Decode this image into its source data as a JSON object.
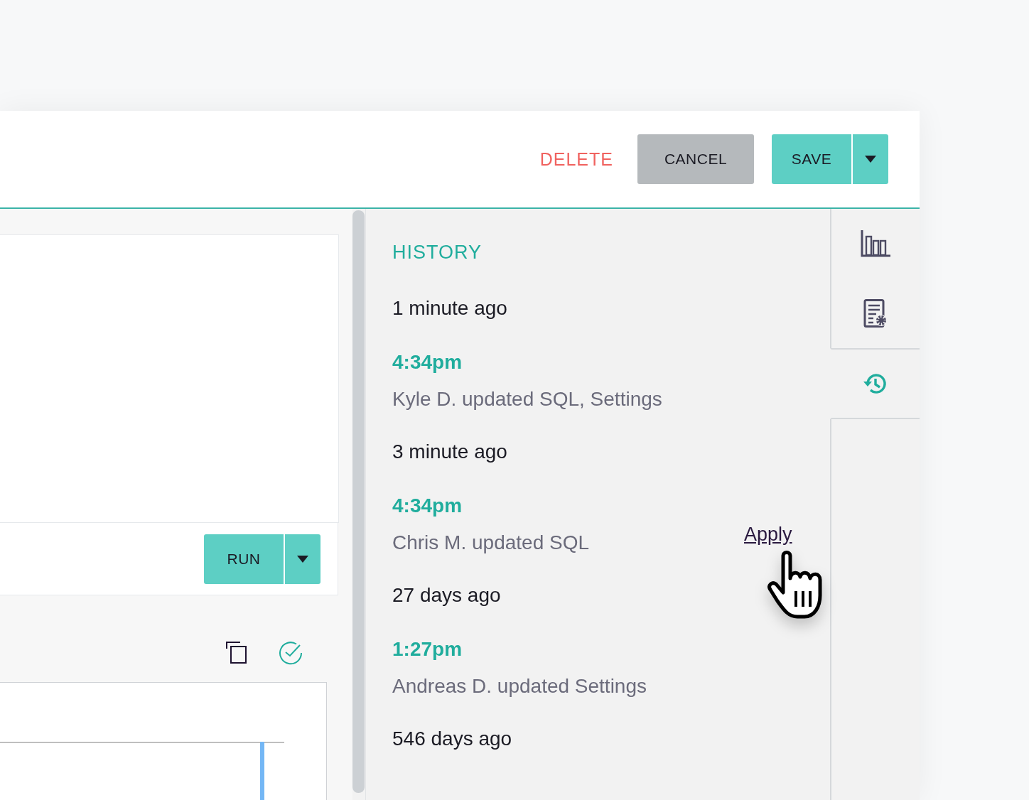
{
  "header": {
    "delete": "DELETE",
    "cancel": "CANCEL",
    "save": "SAVE"
  },
  "editor": {
    "run": "RUN"
  },
  "rail_tabs": [
    {
      "kind": "chart",
      "selected": false
    },
    {
      "kind": "settings",
      "selected": false
    },
    {
      "kind": "history",
      "selected": true
    }
  ],
  "history": {
    "title": "HISTORY",
    "groups": [
      {
        "label": "1 minute ago",
        "events": [
          {
            "time": "4:34pm",
            "description": "Kyle D. updated SQL, Settings"
          }
        ]
      },
      {
        "label": "3 minute ago",
        "events": [
          {
            "time": "4:34pm",
            "description": "Chris M. updated SQL",
            "action": "Apply"
          }
        ]
      },
      {
        "label": "27 days ago",
        "events": [
          {
            "time": "1:27pm",
            "description": "Andreas D. updated Settings"
          }
        ]
      },
      {
        "label": "546 days ago"
      }
    ]
  }
}
